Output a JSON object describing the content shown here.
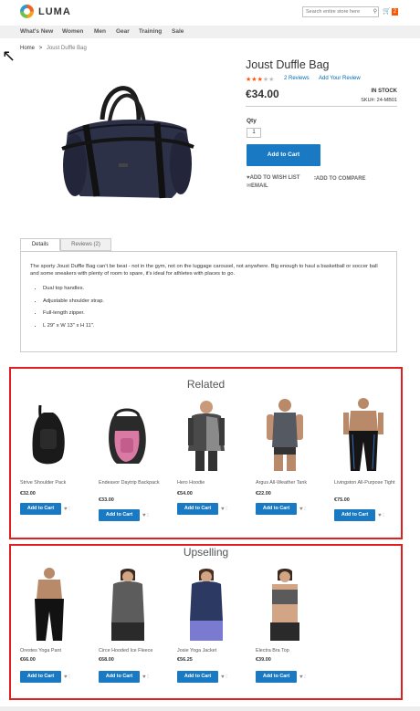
{
  "header": {
    "logo_text": "LUMA",
    "search_placeholder": "Search entire store here",
    "cart_count": "2"
  },
  "nav": {
    "items": [
      "What's New",
      "Women",
      "Men",
      "Gear",
      "Training",
      "Sale"
    ]
  },
  "breadcrumb": {
    "home": "Home",
    "separator": ">",
    "current": "Joust Duffle Bag"
  },
  "product": {
    "title": "Joust Duffle Bag",
    "rating_stars": 3,
    "rating_max": 5,
    "reviews_link": "2 Reviews",
    "add_review": "Add Your Review",
    "price": "€34.00",
    "stock": "IN STOCK",
    "sku_label": "SKU#:",
    "sku": "24-MB01",
    "qty_label": "Qty",
    "qty_value": "1",
    "add_to_cart": "Add to Cart",
    "wishlist": "ADD TO WISH LIST",
    "compare": "ADD TO COMPARE",
    "email": "EMAIL",
    "image_icon": "duffle-bag-image"
  },
  "tabs": [
    {
      "label": "Details",
      "active": true
    },
    {
      "label": "Reviews (2)",
      "active": false
    }
  ],
  "details": {
    "description": "The sporty Joust Duffle Bag can't be beat - not in the gym, not on the luggage carousel, not anywhere. Big enough to haul a basketball or soccer ball and some sneakers with plenty of room to spare, it's ideal for athletes with places to go.",
    "features": [
      "Dual top handles.",
      "Adjustable shoulder strap.",
      "Full-length zipper.",
      "L 29\" x W 13\" x H 11\"."
    ]
  },
  "related": {
    "title": "Related",
    "products": [
      {
        "name": "Strive Shoulder Pack",
        "price": "€32.00",
        "button": "Add to Cart"
      },
      {
        "name": "Endeavor Daytrip Backpack",
        "price": "€33.00",
        "button": "Add to Cart"
      },
      {
        "name": "Hero Hoodie",
        "price": "€54.00",
        "button": "Add to Cart"
      },
      {
        "name": "Argus All-Weather Tank",
        "price": "€22.00",
        "button": "Add to Cart"
      },
      {
        "name": "Livingston All-Purpose Tight",
        "price": "€75.00",
        "button": "Add to Cart"
      }
    ]
  },
  "upselling": {
    "title": "Upselling",
    "products": [
      {
        "name": "Orestes Yoga Pant",
        "price": "€66.00",
        "button": "Add to Cart"
      },
      {
        "name": "Circe Hooded Ice Fleece",
        "price": "€68.00",
        "button": "Add to Cart"
      },
      {
        "name": "Josie Yoga Jacket",
        "price": "€56.25",
        "button": "Add to Cart"
      },
      {
        "name": "Electra Bra Top",
        "price": "€39.00",
        "button": "Add to Cart"
      }
    ]
  },
  "colors": {
    "primary_button": "#1979c3",
    "accent": "#ff5501",
    "highlight_border": "#e02020",
    "link": "#006bb4"
  }
}
